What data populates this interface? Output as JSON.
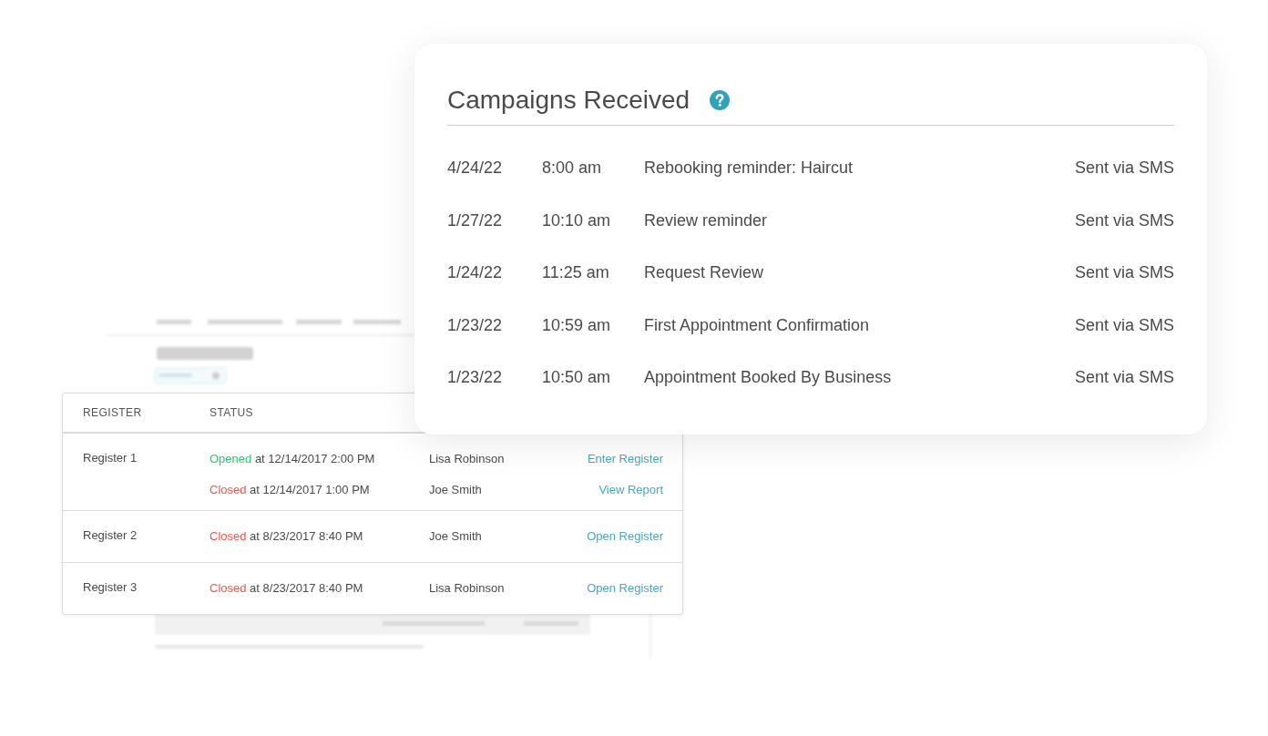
{
  "campaigns": {
    "title": "Campaigns Received",
    "rows": [
      {
        "date": "4/24/22",
        "time": "8:00 am",
        "name": "Rebooking reminder: Haircut",
        "delivery": "Sent via SMS"
      },
      {
        "date": "1/27/22",
        "time": "10:10 am",
        "name": "Review reminder",
        "delivery": "Sent via SMS"
      },
      {
        "date": "1/24/22",
        "time": "11:25 am",
        "name": "Request Review",
        "delivery": "Sent via SMS"
      },
      {
        "date": "1/23/22",
        "time": "10:59 am",
        "name": "First Appointment Confirmation",
        "delivery": "Sent via SMS"
      },
      {
        "date": "1/23/22",
        "time": "10:50 am",
        "name": "Appointment Booked By Business",
        "delivery": "Sent via SMS"
      }
    ]
  },
  "registers": {
    "columns": [
      "REGISTER",
      "STATUS"
    ],
    "rows": [
      {
        "name": "Register 1",
        "entries": [
          {
            "kind": "opened",
            "state": "Opened",
            "detail": "at 12/14/2017 2:00 PM",
            "person": "Lisa Robinson",
            "action": "Enter Register"
          },
          {
            "kind": "closed",
            "state": "Closed",
            "detail": "at 12/14/2017 1:00 PM",
            "person": "Joe Smith",
            "action": "View Report"
          }
        ]
      },
      {
        "name": "Register 2",
        "entries": [
          {
            "kind": "closed",
            "state": "Closed",
            "detail": "at 8/23/2017 8:40 PM",
            "person": "Joe Smith",
            "action": "Open Register"
          }
        ]
      },
      {
        "name": "Register 3",
        "entries": [
          {
            "kind": "closed",
            "state": "Closed",
            "detail": "at 8/23/2017 8:40 PM",
            "person": "Lisa Robinson",
            "action": "Open Register"
          }
        ]
      }
    ]
  }
}
